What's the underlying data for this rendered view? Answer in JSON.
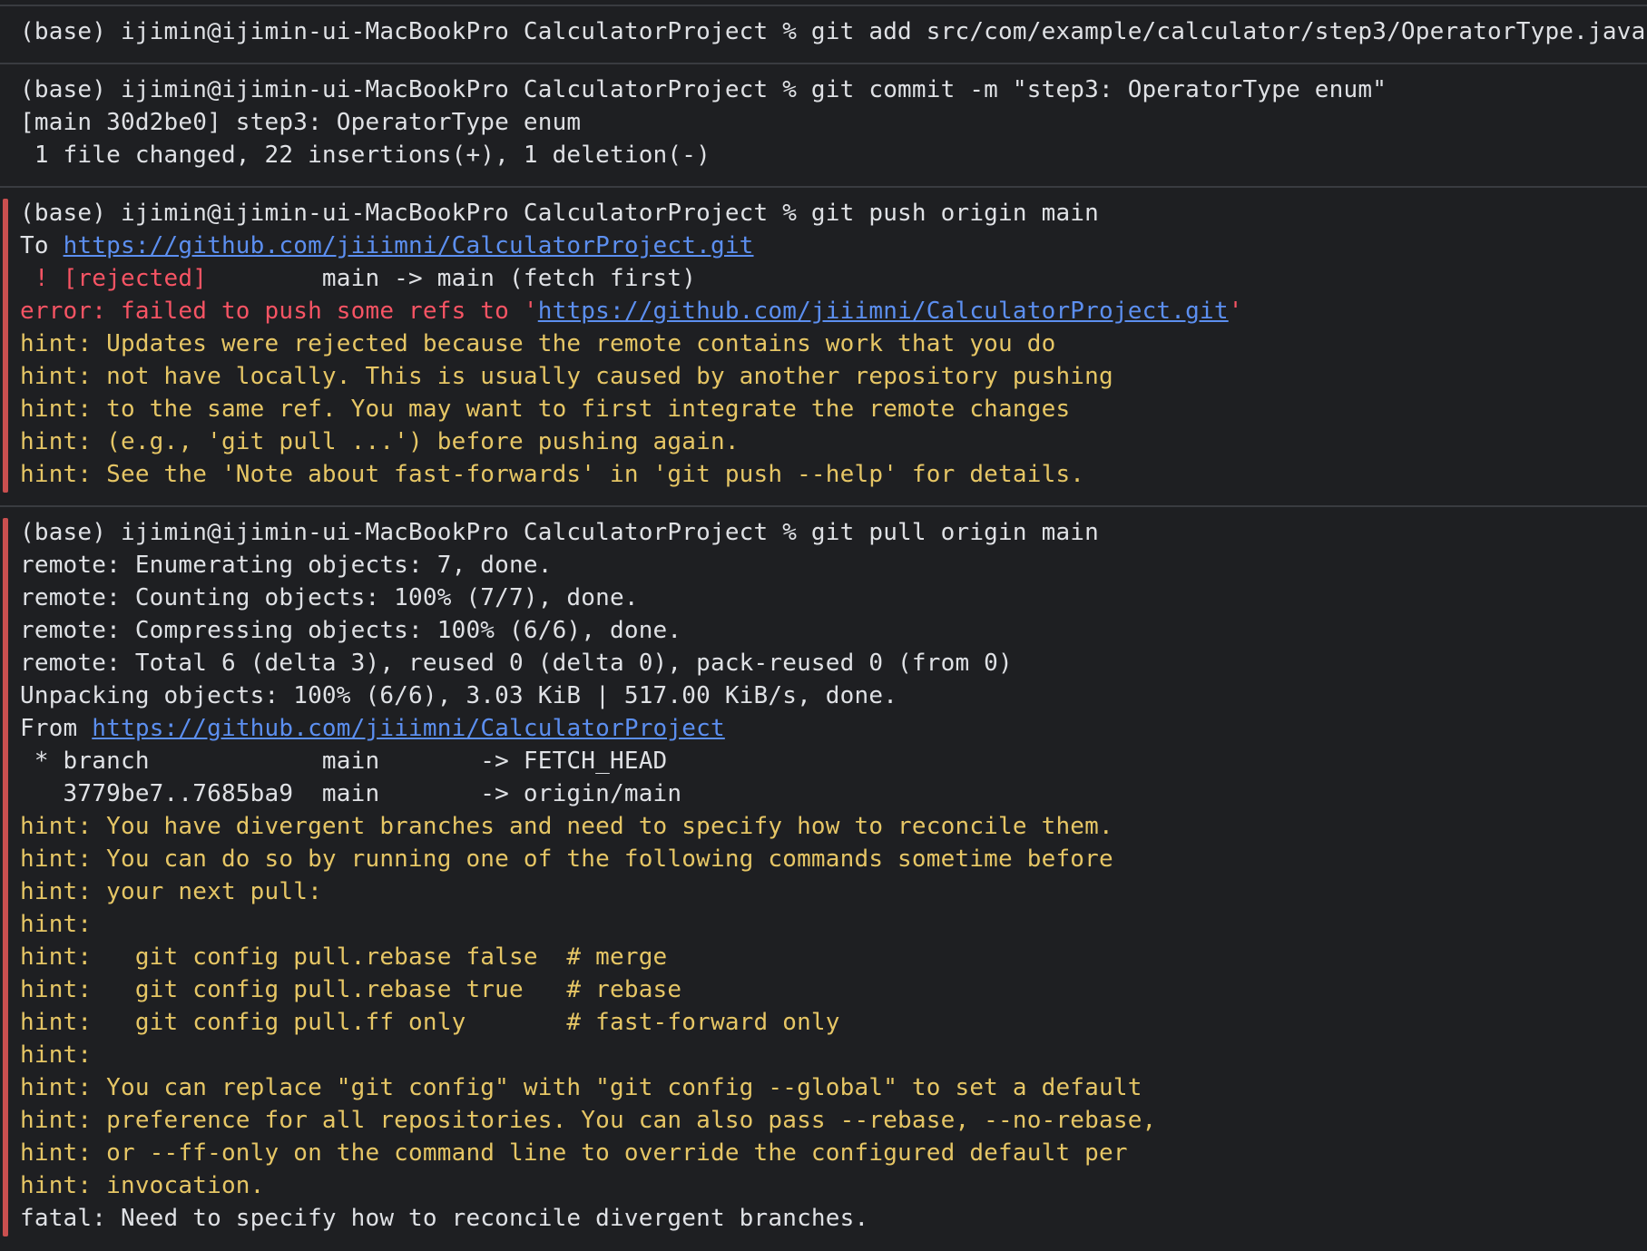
{
  "colors": {
    "background": "#1e1f22",
    "text": "#dfe1e5",
    "error": "#f75464",
    "hint": "#e6c665",
    "link": "#5c8ff0",
    "error_bar": "#c94f4f",
    "divider": "#393b40"
  },
  "blocks": [
    {
      "lines": [
        {
          "cls": "w",
          "parts": [
            {
              "t": "(base) ijimin@ijimin-ui-MacBookPro CalculatorProject % git add src/com/example/calculator/step3/OperatorType.java"
            }
          ]
        }
      ]
    },
    {
      "lines": [
        {
          "cls": "w",
          "parts": [
            {
              "t": "(base) ijimin@ijimin-ui-MacBookPro CalculatorProject % git commit -m \"step3: OperatorType enum\""
            }
          ]
        },
        {
          "cls": "w",
          "parts": [
            {
              "t": "[main 30d2be0] step3: OperatorType enum"
            }
          ]
        },
        {
          "cls": "w",
          "parts": [
            {
              "t": " 1 file changed, 22 insertions(+), 1 deletion(-)"
            }
          ]
        }
      ]
    },
    {
      "error": true,
      "lines": [
        {
          "cls": "w",
          "parts": [
            {
              "t": "(base) ijimin@ijimin-ui-MacBookPro CalculatorProject % git push origin main"
            }
          ]
        },
        {
          "cls": "w",
          "parts": [
            {
              "t": "To "
            },
            {
              "t": "https://github.com/jiiimni/CalculatorProject.git",
              "link": true
            }
          ]
        },
        {
          "cls": "w",
          "parts": [
            {
              "t": " ! [rejected]",
              "c": "red"
            },
            {
              "t": "        main -> main (fetch first)"
            }
          ]
        },
        {
          "cls": "red",
          "parts": [
            {
              "t": "error: failed to push some refs to '"
            },
            {
              "t": "https://github.com/jiiimni/CalculatorProject.git",
              "link": true
            },
            {
              "t": "'"
            }
          ]
        },
        {
          "cls": "hint",
          "parts": [
            {
              "t": "hint: Updates were rejected because the remote contains work that you do"
            }
          ]
        },
        {
          "cls": "hint",
          "parts": [
            {
              "t": "hint: not have locally. This is usually caused by another repository pushing"
            }
          ]
        },
        {
          "cls": "hint",
          "parts": [
            {
              "t": "hint: to the same ref. You may want to first integrate the remote changes"
            }
          ]
        },
        {
          "cls": "hint",
          "parts": [
            {
              "t": "hint: (e.g., 'git pull ...') before pushing again."
            }
          ]
        },
        {
          "cls": "hint",
          "parts": [
            {
              "t": "hint: See the 'Note about fast-forwards' in 'git push --help' for details."
            }
          ]
        }
      ]
    },
    {
      "error": true,
      "lines": [
        {
          "cls": "w",
          "parts": [
            {
              "t": "(base) ijimin@ijimin-ui-MacBookPro CalculatorProject % git pull origin main"
            }
          ]
        },
        {
          "cls": "w",
          "parts": [
            {
              "t": "remote: Enumerating objects: 7, done."
            }
          ]
        },
        {
          "cls": "w",
          "parts": [
            {
              "t": "remote: Counting objects: 100% (7/7), done."
            }
          ]
        },
        {
          "cls": "w",
          "parts": [
            {
              "t": "remote: Compressing objects: 100% (6/6), done."
            }
          ]
        },
        {
          "cls": "w",
          "parts": [
            {
              "t": "remote: Total 6 (delta 3), reused 0 (delta 0), pack-reused 0 (from 0)"
            }
          ]
        },
        {
          "cls": "w",
          "parts": [
            {
              "t": "Unpacking objects: 100% (6/6), 3.03 KiB | 517.00 KiB/s, done."
            }
          ]
        },
        {
          "cls": "w",
          "parts": [
            {
              "t": "From "
            },
            {
              "t": "https://github.com/jiiimni/CalculatorProject",
              "link": true
            }
          ]
        },
        {
          "cls": "w",
          "parts": [
            {
              "t": " * branch            main       -> FETCH_HEAD"
            }
          ]
        },
        {
          "cls": "w",
          "parts": [
            {
              "t": "   3779be7..7685ba9  main       -> origin/main"
            }
          ]
        },
        {
          "cls": "hint",
          "parts": [
            {
              "t": "hint: You have divergent branches and need to specify how to reconcile them."
            }
          ]
        },
        {
          "cls": "hint",
          "parts": [
            {
              "t": "hint: You can do so by running one of the following commands sometime before"
            }
          ]
        },
        {
          "cls": "hint",
          "parts": [
            {
              "t": "hint: your next pull:"
            }
          ]
        },
        {
          "cls": "hint",
          "parts": [
            {
              "t": "hint:"
            }
          ]
        },
        {
          "cls": "hint",
          "parts": [
            {
              "t": "hint:   git config pull.rebase false  # merge"
            }
          ]
        },
        {
          "cls": "hint",
          "parts": [
            {
              "t": "hint:   git config pull.rebase true   # rebase"
            }
          ]
        },
        {
          "cls": "hint",
          "parts": [
            {
              "t": "hint:   git config pull.ff only       # fast-forward only"
            }
          ]
        },
        {
          "cls": "hint",
          "parts": [
            {
              "t": "hint:"
            }
          ]
        },
        {
          "cls": "hint",
          "parts": [
            {
              "t": "hint: You can replace \"git config\" with \"git config --global\" to set a default"
            }
          ]
        },
        {
          "cls": "hint",
          "parts": [
            {
              "t": "hint: preference for all repositories. You can also pass --rebase, --no-rebase,"
            }
          ]
        },
        {
          "cls": "hint",
          "parts": [
            {
              "t": "hint: or --ff-only on the command line to override the configured default per"
            }
          ]
        },
        {
          "cls": "hint",
          "parts": [
            {
              "t": "hint: invocation."
            }
          ]
        },
        {
          "cls": "w",
          "parts": [
            {
              "t": "fatal: Need to specify how to reconcile divergent branches."
            }
          ]
        }
      ]
    }
  ]
}
